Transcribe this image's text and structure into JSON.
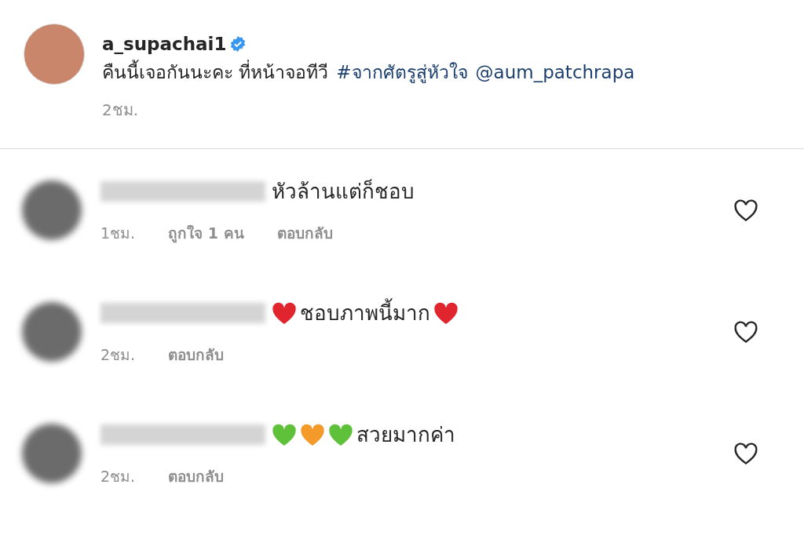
{
  "post": {
    "username": "a_supachai1",
    "verified": true,
    "caption": "คืนนี้เจอกันนะคะ ที่หน้าจอทีวี",
    "hashtag": "#จากศัตรูสู่หัวใจ",
    "mention": "@aum_patchrapa",
    "time": "2ชม."
  },
  "comments": [
    {
      "parts": [
        {
          "kind": "text",
          "text": "หัวล้านแต่ก็ชอบ"
        }
      ],
      "time": "1ชม.",
      "likes": "ถูกใจ 1 คน",
      "reply": "ตอบกลับ",
      "liked": false
    },
    {
      "parts": [
        {
          "kind": "heart",
          "color": "#e0252e"
        },
        {
          "kind": "text",
          "text": "ชอบภาพนี้มาก"
        },
        {
          "kind": "heart",
          "color": "#e0252e"
        }
      ],
      "time": "2ชม.",
      "reply": "ตอบกลับ",
      "liked": false
    },
    {
      "parts": [
        {
          "kind": "heart",
          "color": "#5fc13a"
        },
        {
          "kind": "heart",
          "color": "#f39a2b"
        },
        {
          "kind": "heart",
          "color": "#5fc13a"
        },
        {
          "kind": "text",
          "text": "สวยมากค่า"
        }
      ],
      "time": "2ชม.",
      "reply": "ตอบกลับ",
      "liked": false
    }
  ]
}
